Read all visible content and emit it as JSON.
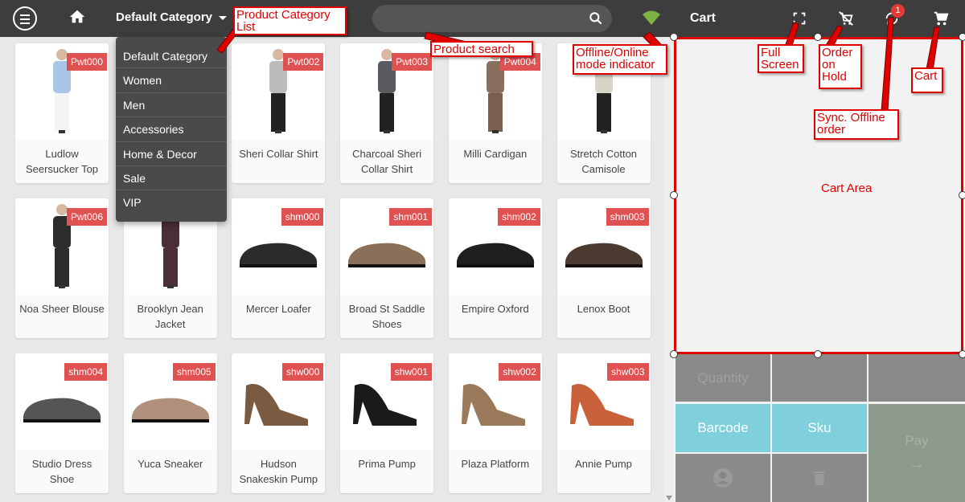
{
  "header": {
    "category_label": "Default Category",
    "search_placeholder": "",
    "cart_title": "Cart",
    "sync_badge": "1"
  },
  "categories": [
    "Default Category",
    "Women",
    "Men",
    "Accessories",
    "Home & Decor",
    "Sale",
    "VIP"
  ],
  "products": [
    {
      "sku": "Pwt000",
      "name": "Ludlow Seersucker Top"
    },
    {
      "sku": "",
      "name": ""
    },
    {
      "sku": "Pwt002",
      "name": "Sheri Collar Shirt"
    },
    {
      "sku": "Pwt003",
      "name": "Charcoal Sheri Collar Shirt"
    },
    {
      "sku": "Pwt004",
      "name": "Milli Cardigan"
    },
    {
      "sku": "",
      "name": "Stretch Cotton Camisole"
    },
    {
      "sku": "Pwt006",
      "name": "Noa Sheer Blouse"
    },
    {
      "sku": "",
      "name": "Brooklyn Jean Jacket"
    },
    {
      "sku": "shm000",
      "name": "Mercer Loafer"
    },
    {
      "sku": "shm001",
      "name": "Broad St Saddle Shoes"
    },
    {
      "sku": "shm002",
      "name": "Empire Oxford"
    },
    {
      "sku": "shm003",
      "name": "Lenox Boot"
    },
    {
      "sku": "shm004",
      "name": "Studio Dress Shoe"
    },
    {
      "sku": "shm005",
      "name": "Yuca Sneaker"
    },
    {
      "sku": "shw000",
      "name": "Hudson Snakeskin Pump"
    },
    {
      "sku": "shw001",
      "name": "Prima Pump"
    },
    {
      "sku": "shw002",
      "name": "Plaza Platform"
    },
    {
      "sku": "shw003",
      "name": "Annie Pump"
    }
  ],
  "cart": {
    "area_label": "Cart Area",
    "keys": {
      "quantity": "Quantity",
      "barcode": "Barcode",
      "sku": "Sku",
      "pay": "Pay"
    }
  },
  "annotations": {
    "product_category_list": "Product Category List",
    "product_search": "Product search",
    "offline_online": "Offline/Online mode indicator",
    "full_screen": "Full Screen",
    "order_on_hold": "Order on Hold",
    "cart": "Cart",
    "sync_offline": "Sync. Offline order"
  },
  "colors": {
    "header_bg": "#3d3d3d",
    "sku_badge": "#e05252",
    "annotation_red": "#e00000",
    "barcode_key": "#7fd0dc",
    "wifi_green": "#7cb342"
  }
}
